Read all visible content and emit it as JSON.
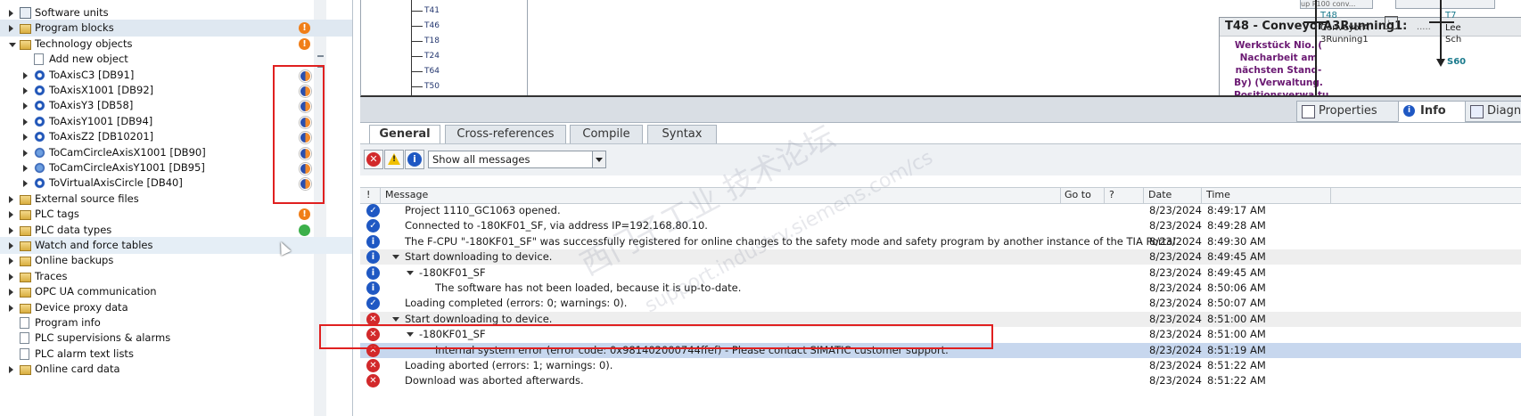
{
  "tree": {
    "items": [
      {
        "label": "Software units",
        "arrow": "right",
        "icon": "block",
        "indent": 0
      },
      {
        "label": "Program blocks",
        "arrow": "right",
        "icon": "folder",
        "indent": 0,
        "status": "!"
      },
      {
        "label": "Technology objects",
        "arrow": "down",
        "icon": "folder",
        "indent": 0,
        "status": "!"
      },
      {
        "label": "Add new object",
        "arrow": "none",
        "icon": "add",
        "indent": 1
      },
      {
        "label": "ToAxisC3 [DB91]",
        "arrow": "right",
        "icon": "gear",
        "indent": 1
      },
      {
        "label": "ToAxisX1001 [DB92]",
        "arrow": "right",
        "icon": "gear",
        "indent": 1
      },
      {
        "label": "ToAxisY3 [DB58]",
        "arrow": "right",
        "icon": "gear",
        "indent": 1
      },
      {
        "label": "ToAxisY1001 [DB94]",
        "arrow": "right",
        "icon": "gear",
        "indent": 1
      },
      {
        "label": "ToAxisZ2 [DB10201]",
        "arrow": "right",
        "icon": "gear",
        "indent": 1
      },
      {
        "label": "ToCamCircleAxisX1001 [DB90]",
        "arrow": "right",
        "icon": "cam",
        "indent": 1
      },
      {
        "label": "ToCamCircleAxisY1001 [DB95]",
        "arrow": "right",
        "icon": "cam",
        "indent": 1
      },
      {
        "label": "ToVirtualAxisCircle [DB40]",
        "arrow": "right",
        "icon": "gear",
        "indent": 1
      },
      {
        "label": "External source files",
        "arrow": "right",
        "icon": "folder",
        "indent": 0
      },
      {
        "label": "PLC tags",
        "arrow": "right",
        "icon": "folder",
        "indent": 0,
        "status": "!"
      },
      {
        "label": "PLC data types",
        "arrow": "right",
        "icon": "folder",
        "indent": 0,
        "status": "green"
      },
      {
        "label": "Watch and force tables",
        "arrow": "right",
        "icon": "folder",
        "indent": 0
      },
      {
        "label": "Online backups",
        "arrow": "right",
        "icon": "folder",
        "indent": 0
      },
      {
        "label": "Traces",
        "arrow": "right",
        "icon": "folder",
        "indent": 0
      },
      {
        "label": "OPC UA communication",
        "arrow": "right",
        "icon": "folder",
        "indent": 0
      },
      {
        "label": "Device proxy data",
        "arrow": "right",
        "icon": "folder",
        "indent": 0
      },
      {
        "label": "Program info",
        "arrow": "none",
        "icon": "doc",
        "indent": 0
      },
      {
        "label": "PLC supervisions & alarms",
        "arrow": "none",
        "icon": "doc",
        "indent": 0
      },
      {
        "label": "PLC alarm text lists",
        "arrow": "none",
        "icon": "doc",
        "indent": 0
      },
      {
        "label": "Online card data",
        "arrow": "right",
        "icon": "folder",
        "indent": 0
      }
    ]
  },
  "diagram": {
    "transitions": [
      "T41",
      "T46",
      "T18",
      "T24",
      "T64",
      "T50"
    ],
    "box_title": "T48 - ConveyorA3Running1:",
    "box_dots": ".....",
    "box_text": "Werkstück Nio. ( Nacharbeit am nächsten Stand-By) (Verwaltung. Positionsverwaltu...",
    "right_label_top": "up P100 conv...",
    "right_t": "T48",
    "right_line1": "ConveyorA",
    "right_line2": "3Running1",
    "far_t": "T7",
    "far_line1": "Lee",
    "far_line2": "Sch",
    "far_s": "S60"
  },
  "inspector": {
    "tabs": [
      "Properties",
      "Info",
      "Diagn"
    ]
  },
  "info": {
    "subtabs": [
      "General",
      "Cross-references",
      "Compile",
      "Syntax"
    ],
    "filter_value": "Show all messages",
    "columns": {
      "flag": "!",
      "message": "Message",
      "goto": "Go to",
      "q": "?",
      "date": "Date",
      "time": "Time"
    },
    "messages": [
      {
        "icon": "ok",
        "indent": 0,
        "expand": false,
        "text": "Project 1110_GC1063 opened.",
        "date": "8/23/2024",
        "time": "8:49:17 AM"
      },
      {
        "icon": "ok",
        "indent": 0,
        "expand": false,
        "text": "Connected to -180KF01_SF, via address IP=192.168.80.10.",
        "date": "8/23/2024",
        "time": "8:49:28 AM"
      },
      {
        "icon": "info",
        "indent": 0,
        "expand": false,
        "text": "The F-CPU \"-180KF01_SF\" was successfully registered for online changes to the safety mode and safety program by another instance of the TIA Portal.",
        "date": "8/23/2024",
        "time": "8:49:30 AM"
      },
      {
        "icon": "info",
        "indent": 0,
        "expand": true,
        "text": "Start downloading to device.",
        "date": "8/23/2024",
        "time": "8:49:45 AM",
        "grey": true
      },
      {
        "icon": "info",
        "indent": 1,
        "expand": true,
        "text": "-180KF01_SF",
        "date": "8/23/2024",
        "time": "8:49:45 AM"
      },
      {
        "icon": "info",
        "indent": 2,
        "expand": false,
        "text": "The software has not been loaded, because it is up-to-date.",
        "date": "8/23/2024",
        "time": "8:50:06 AM"
      },
      {
        "icon": "ok",
        "indent": 0,
        "expand": false,
        "text": "Loading completed (errors: 0; warnings: 0).",
        "date": "8/23/2024",
        "time": "8:50:07 AM"
      },
      {
        "icon": "err",
        "indent": 0,
        "expand": true,
        "text": "Start downloading to device.",
        "date": "8/23/2024",
        "time": "8:51:00 AM",
        "grey": true
      },
      {
        "icon": "err",
        "indent": 1,
        "expand": true,
        "text": "-180KF01_SF",
        "date": "8/23/2024",
        "time": "8:51:00 AM"
      },
      {
        "icon": "err",
        "indent": 2,
        "expand": false,
        "text": "Internal system error (error code: 0x981402000744ffef) - Please contact SIMATIC customer support.",
        "date": "8/23/2024",
        "time": "8:51:19 AM",
        "selected": true
      },
      {
        "icon": "err",
        "indent": 0,
        "expand": false,
        "text": "Loading aborted (errors: 1; warnings: 0).",
        "date": "8/23/2024",
        "time": "8:51:22 AM"
      },
      {
        "icon": "err",
        "indent": 0,
        "expand": false,
        "text": "Download was aborted afterwards.",
        "date": "8/23/2024",
        "time": "8:51:22 AM"
      }
    ]
  },
  "watermark": {
    "line1": "西门子工业 技术论坛",
    "line2": "support.industry.siemens.com/cs"
  }
}
